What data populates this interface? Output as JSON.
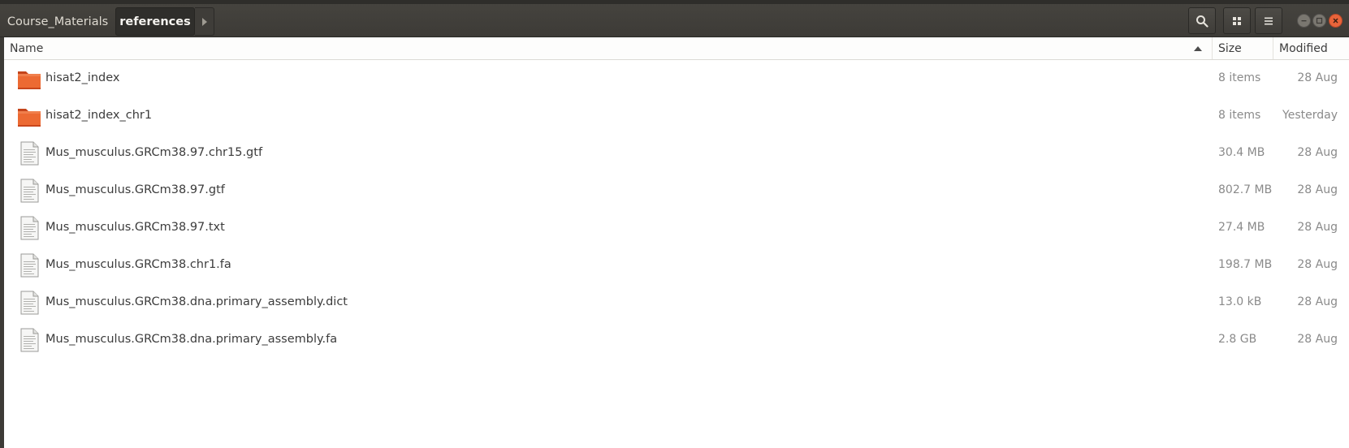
{
  "breadcrumb": {
    "items": [
      "Course_Materials",
      "references"
    ]
  },
  "toolbar": {
    "search_icon": "search-icon",
    "view_icon": "grid-view-icon",
    "menu_icon": "hamburger-menu-icon"
  },
  "window_controls": [
    "minimize",
    "maximize",
    "close"
  ],
  "columns": {
    "name": "Name",
    "size": "Size",
    "modified": "Modified",
    "sort": "ascending"
  },
  "files": [
    {
      "name": "hisat2_index",
      "size": "8 items",
      "modified": "28 Aug",
      "type": "folder"
    },
    {
      "name": "hisat2_index_chr1",
      "size": "8 items",
      "modified": "Yesterday",
      "type": "folder"
    },
    {
      "name": "Mus_musculus.GRCm38.97.chr15.gtf",
      "size": "30.4 MB",
      "modified": "28 Aug",
      "type": "file"
    },
    {
      "name": "Mus_musculus.GRCm38.97.gtf",
      "size": "802.7 MB",
      "modified": "28 Aug",
      "type": "file"
    },
    {
      "name": "Mus_musculus.GRCm38.97.txt",
      "size": "27.4 MB",
      "modified": "28 Aug",
      "type": "file"
    },
    {
      "name": "Mus_musculus.GRCm38.chr1.fa",
      "size": "198.7 MB",
      "modified": "28 Aug",
      "type": "file"
    },
    {
      "name": "Mus_musculus.GRCm38.dna.primary_assembly.dict",
      "size": "13.0 kB",
      "modified": "28 Aug",
      "type": "file"
    },
    {
      "name": "Mus_musculus.GRCm38.dna.primary_assembly.fa",
      "size": "2.8 GB",
      "modified": "28 Aug",
      "type": "file"
    }
  ],
  "colors": {
    "headerbar": "#3d3b37",
    "folder": "#e95420",
    "close_button": "#e9643a"
  }
}
